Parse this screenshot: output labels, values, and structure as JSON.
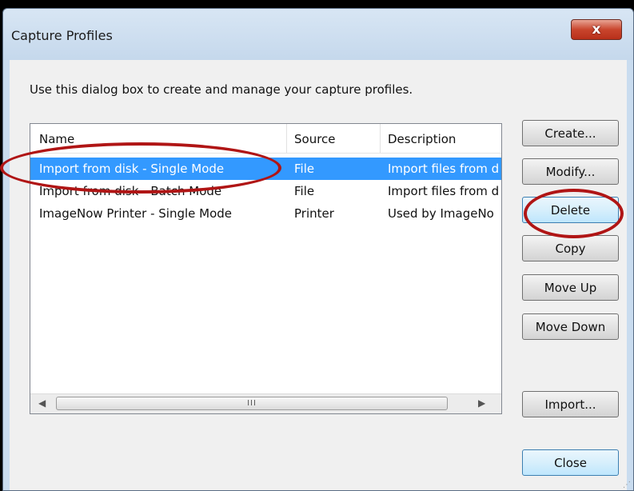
{
  "window": {
    "title": "Capture Profiles",
    "close_glyph": "x"
  },
  "instructions": "Use this dialog box to create and manage your capture profiles.",
  "list": {
    "columns": [
      "Name",
      "Source",
      "Description"
    ],
    "rows": [
      {
        "name": "Import from disk - Single Mode",
        "source": "File",
        "description": "Import files from d",
        "selected": true
      },
      {
        "name": "Import from disk - Batch Mode",
        "source": "File",
        "description": "Import files from d",
        "selected": false
      },
      {
        "name": "ImageNow Printer - Single Mode",
        "source": "Printer",
        "description": "Used by ImageNo",
        "selected": false
      }
    ],
    "scrollbar": {
      "left_arrow": "◀",
      "right_arrow": "▶",
      "grip": "III"
    }
  },
  "buttons": {
    "create": "Create...",
    "modify": "Modify...",
    "delete": "Delete",
    "copy": "Copy",
    "move_up": "Move Up",
    "move_down": "Move Down",
    "import": "Import...",
    "close": "Close"
  },
  "annotation_color": "#b01515",
  "selection_color": "#3399ff"
}
